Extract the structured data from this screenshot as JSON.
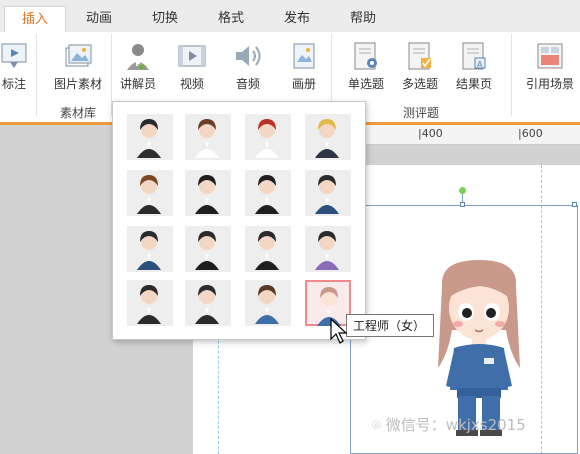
{
  "tabs": [
    {
      "label": "插入",
      "active": true
    },
    {
      "label": "动画"
    },
    {
      "label": "切换"
    },
    {
      "label": "格式"
    },
    {
      "label": "发布"
    },
    {
      "label": "帮助"
    }
  ],
  "ribbon": {
    "buttons": {
      "annotate": "标注",
      "image_material": "图片素材",
      "narrator": "讲解员",
      "video": "视频",
      "audio": "音频",
      "album": "画册",
      "single_choice": "单选题",
      "multi_choice": "多选题",
      "result_page": "结果页",
      "reference_scene": "引用场景"
    },
    "groups": {
      "material_library": "素材库",
      "quiz": "测评题"
    }
  },
  "ruler": {
    "mark_400": "400",
    "mark_600": "600"
  },
  "narrator_popup": {
    "characters": [
      {
        "name": "female-exec-1"
      },
      {
        "name": "female-exec-2"
      },
      {
        "name": "female-exec-3"
      },
      {
        "name": "female-exec-4"
      },
      {
        "name": "male-presenter-1"
      },
      {
        "name": "female-presenter-1"
      },
      {
        "name": "female-presenter-2"
      },
      {
        "name": "male-presenter-2"
      },
      {
        "name": "male-presenter-3"
      },
      {
        "name": "male-presenter-4"
      },
      {
        "name": "male-presenter-5"
      },
      {
        "name": "male-glasses"
      },
      {
        "name": "male-small"
      },
      {
        "name": "male-manager"
      },
      {
        "name": "male-boy"
      },
      {
        "name": "female-engineer"
      }
    ],
    "selected_index": 15
  },
  "tooltip": "工程师（女）",
  "watermark": "微信号：wkjxs2015"
}
